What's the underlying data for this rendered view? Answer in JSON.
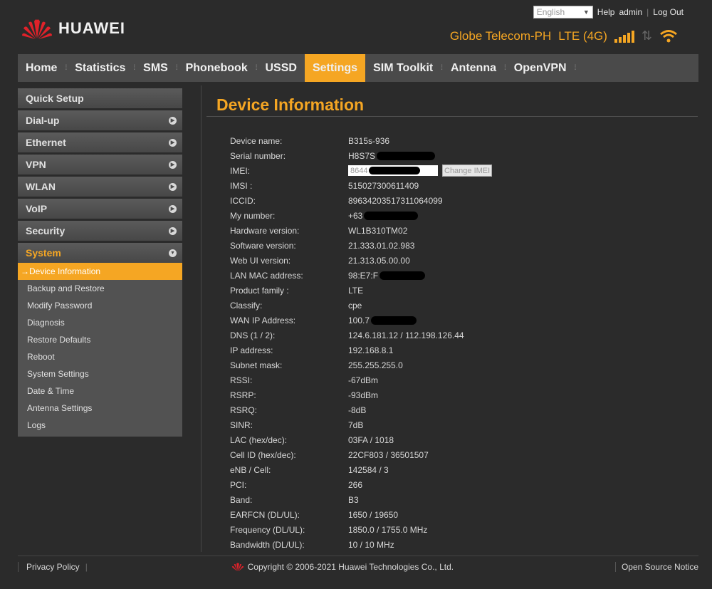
{
  "header": {
    "language": "English",
    "help": "Help",
    "user": "admin",
    "logout": "Log Out",
    "brand": "HUAWEI",
    "operator": "Globe Telecom-PH",
    "network": "LTE (4G)"
  },
  "nav": {
    "items": [
      {
        "label": "Home"
      },
      {
        "label": "Statistics"
      },
      {
        "label": "SMS"
      },
      {
        "label": "Phonebook"
      },
      {
        "label": "USSD"
      },
      {
        "label": "Settings"
      },
      {
        "label": "SIM Toolkit"
      },
      {
        "label": "Antenna"
      },
      {
        "label": "OpenVPN"
      }
    ],
    "active": "Settings"
  },
  "sidebar": {
    "groups": [
      {
        "label": "Quick Setup"
      },
      {
        "label": "Dial-up"
      },
      {
        "label": "Ethernet"
      },
      {
        "label": "VPN"
      },
      {
        "label": "WLAN"
      },
      {
        "label": "VoIP"
      },
      {
        "label": "Security"
      },
      {
        "label": "System"
      }
    ],
    "system_items": [
      {
        "label": "Device Information"
      },
      {
        "label": "Backup and Restore"
      },
      {
        "label": "Modify Password"
      },
      {
        "label": "Diagnosis"
      },
      {
        "label": "Restore Defaults"
      },
      {
        "label": "Reboot"
      },
      {
        "label": "System Settings"
      },
      {
        "label": "Date & Time"
      },
      {
        "label": "Antenna Settings"
      },
      {
        "label": "Logs"
      }
    ]
  },
  "main": {
    "title": "Device Information",
    "imei_value": "8644",
    "change_imei": "Change IMEI",
    "rows": [
      {
        "label": "Device name:",
        "value": "B315s-936"
      },
      {
        "label": "Serial number:",
        "value": "H8S7S"
      },
      {
        "label": "IMEI:",
        "value": ""
      },
      {
        "label": "IMSI :",
        "value": "515027300611409"
      },
      {
        "label": "ICCID:",
        "value": "89634203517311064099"
      },
      {
        "label": "My number:",
        "value": "+63"
      },
      {
        "label": "Hardware version:",
        "value": "WL1B310TM02"
      },
      {
        "label": "Software version:",
        "value": "21.333.01.02.983"
      },
      {
        "label": "Web UI version:",
        "value": "21.313.05.00.00"
      },
      {
        "label": "LAN MAC address:",
        "value": "98:E7:F"
      },
      {
        "label": "Product family :",
        "value": "LTE"
      },
      {
        "label": "Classify:",
        "value": "cpe"
      },
      {
        "label": "WAN IP Address:",
        "value": "100.7"
      },
      {
        "label": "DNS (1 / 2):",
        "value": "124.6.181.12 / 112.198.126.44"
      },
      {
        "label": "IP address:",
        "value": "192.168.8.1"
      },
      {
        "label": "Subnet mask:",
        "value": "255.255.255.0"
      },
      {
        "label": "RSSI:",
        "value": "-67dBm"
      },
      {
        "label": "RSRP:",
        "value": "-93dBm"
      },
      {
        "label": "RSRQ:",
        "value": "-8dB"
      },
      {
        "label": "SINR:",
        "value": "7dB"
      },
      {
        "label": "LAC (hex/dec):",
        "value": "03FA / 1018"
      },
      {
        "label": "Cell ID (hex/dec):",
        "value": "22CF803 / 36501507"
      },
      {
        "label": "eNB / Cell:",
        "value": "142584 / 3"
      },
      {
        "label": "PCI:",
        "value": "266"
      },
      {
        "label": "Band:",
        "value": "B3"
      },
      {
        "label": "EARFCN (DL/UL):",
        "value": "1650 / 19650"
      },
      {
        "label": "Frequency (DL/UL):",
        "value": "1850.0 / 1755.0 MHz"
      },
      {
        "label": "Bandwidth (DL/UL):",
        "value": "10 / 10 MHz"
      }
    ]
  },
  "footer": {
    "privacy": "Privacy Policy",
    "copyright": "Copyright © 2006-2021 Huawei Technologies Co., Ltd.",
    "open_source": "Open Source Notice"
  },
  "colors": {
    "accent": "#f5a623",
    "background": "#2b2b2b",
    "nav": "#4a4a4a"
  }
}
